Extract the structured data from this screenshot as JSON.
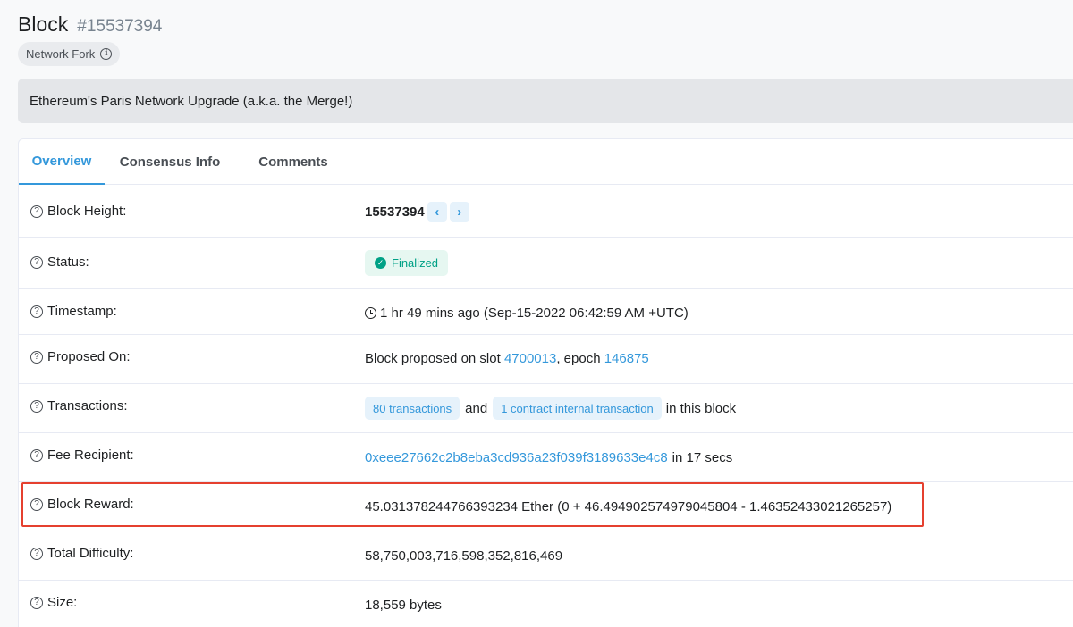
{
  "header": {
    "title": "Block",
    "block_number": "#15537394",
    "fork_badge": "Network Fork"
  },
  "banner": {
    "text": "Ethereum's Paris Network Upgrade (a.k.a. the Merge!)"
  },
  "tabs": [
    {
      "label": "Overview",
      "active": true
    },
    {
      "label": "Consensus Info",
      "active": false
    },
    {
      "label": "Comments",
      "active": false
    }
  ],
  "rows": {
    "block_height": {
      "label": "Block Height:",
      "value": "15537394"
    },
    "status": {
      "label": "Status:",
      "value": "Finalized"
    },
    "timestamp": {
      "label": "Timestamp:",
      "value": "1 hr 49 mins ago (Sep-15-2022 06:42:59 AM +UTC)"
    },
    "proposed_on": {
      "label": "Proposed On:",
      "prefix": "Block proposed on slot ",
      "slot": "4700013",
      "middle": ", epoch ",
      "epoch": "146875"
    },
    "transactions": {
      "label": "Transactions:",
      "tx_count": "80 transactions",
      "and_text": "and",
      "internal_count": "1 contract internal transaction",
      "suffix": "in this block"
    },
    "fee_recipient": {
      "label": "Fee Recipient:",
      "address": "0xeee27662c2b8eba3cd936a23f039f3189633e4c8",
      "suffix": "in 17 secs"
    },
    "block_reward": {
      "label": "Block Reward:",
      "value": "45.031378244766393234 Ether (0 + 46.494902574979045804 - 1.46352433021265257)"
    },
    "total_difficulty": {
      "label": "Total Difficulty:",
      "value": "58,750,003,716,598,352,816,469"
    },
    "size": {
      "label": "Size:",
      "value": "18,559 bytes"
    }
  },
  "colors": {
    "accent": "#3498db",
    "success": "#00a186",
    "highlight": "#e5402f"
  }
}
